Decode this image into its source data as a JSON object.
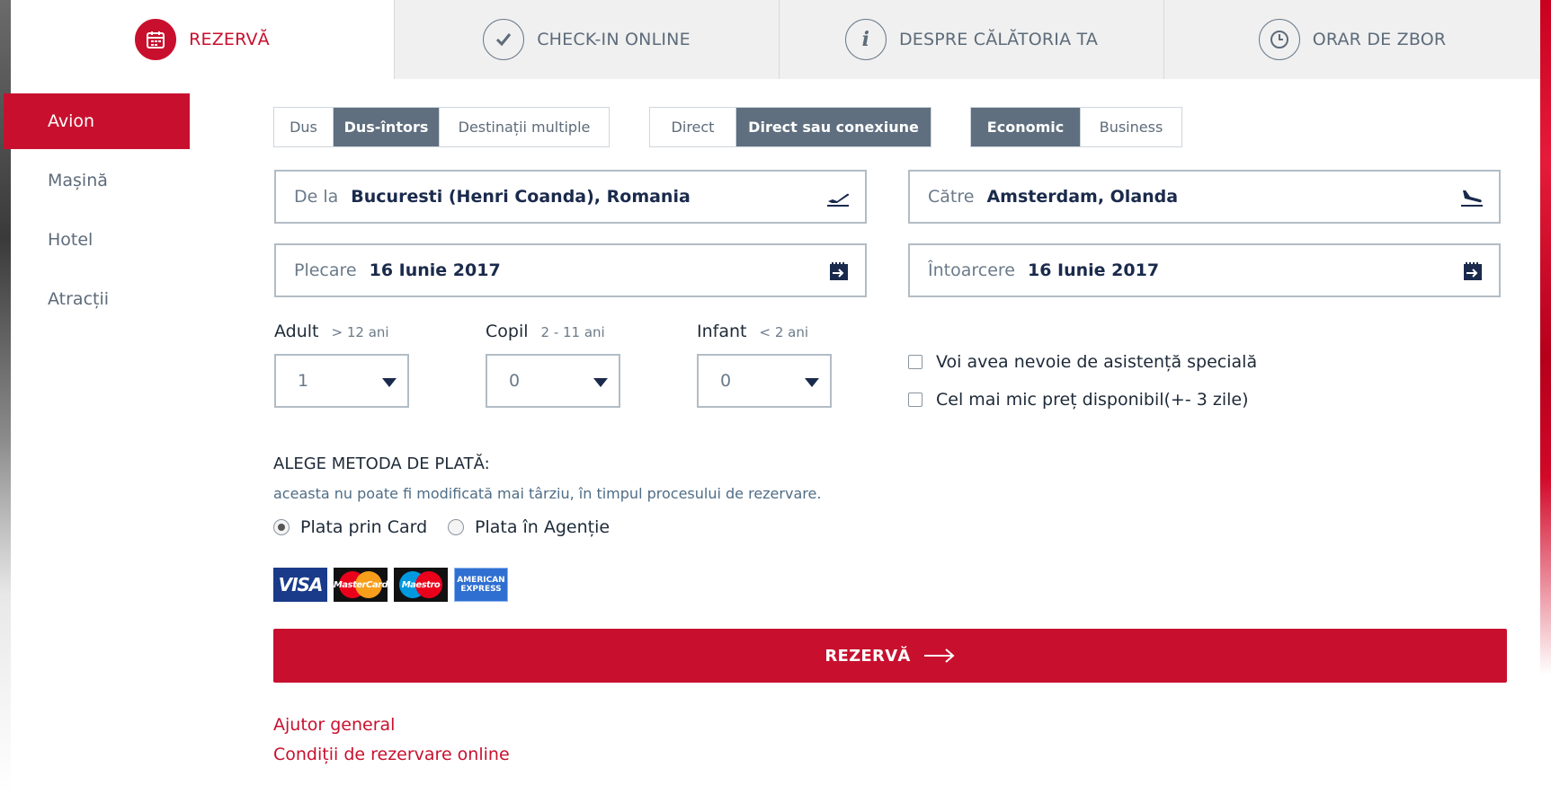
{
  "tabs": [
    {
      "label": "REZERVĂ",
      "icon": "calendar-icon",
      "active": true
    },
    {
      "label": "CHECK-IN ONLINE",
      "icon": "checkmark-icon",
      "active": false
    },
    {
      "label": "DESPRE CĂLĂTORIA TA",
      "icon": "info-icon",
      "active": false
    },
    {
      "label": "ORAR DE ZBOR",
      "icon": "clock-icon",
      "active": false
    }
  ],
  "sidebar": {
    "items": [
      {
        "label": "Avion",
        "active": true
      },
      {
        "label": "Mașină",
        "active": false
      },
      {
        "label": "Hotel",
        "active": false
      },
      {
        "label": "Atracții",
        "active": false
      }
    ]
  },
  "trip_type": {
    "options": [
      "Dus",
      "Dus-întors",
      "Destinații multiple"
    ],
    "selected": "Dus-întors"
  },
  "connection": {
    "options": [
      "Direct",
      "Direct sau conexiune"
    ],
    "selected": "Direct sau conexiune"
  },
  "cabin": {
    "options": [
      "Economic",
      "Business"
    ],
    "selected": "Economic"
  },
  "from": {
    "label": "De la",
    "value": "Bucuresti (Henri Coanda), Romania"
  },
  "to": {
    "label": "Către",
    "value": "Amsterdam, Olanda"
  },
  "departure": {
    "label": "Plecare",
    "value": "16 Iunie 2017"
  },
  "return": {
    "label": "Întoarcere",
    "value": "16 Iunie 2017"
  },
  "passengers": {
    "adult": {
      "label": "Adult",
      "hint": "> 12 ani",
      "value": "1"
    },
    "child": {
      "label": "Copil",
      "hint": "2 - 11 ani",
      "value": "0"
    },
    "infant": {
      "label": "Infant",
      "hint": "< 2 ani",
      "value": "0"
    }
  },
  "options": {
    "special_assistance": "Voi avea nevoie de asistență specială",
    "lowest_price": "Cel mai mic preț disponibil(+- 3 zile)"
  },
  "payment": {
    "title": "ALEGE METODA DE PLATĂ:",
    "subtitle": "aceasta nu poate fi modificată mai târziu, în timpul procesului de rezervare.",
    "card_label": "Plata prin Card",
    "agency_label": "Plata în Agenție",
    "selected": "card",
    "cards": {
      "visa": "VISA",
      "mastercard": "MasterCard",
      "maestro": "Maestro",
      "amex_line1": "AMERICAN",
      "amex_line2": "EXPRESS"
    }
  },
  "submit_label": "REZERVĂ",
  "links": {
    "help": "Ajutor general",
    "conditions": "Condiții de rezervare online"
  },
  "colors": {
    "brand_red": "#c8102e",
    "slate": "#5f6f7f",
    "navy": "#1a2a4c"
  }
}
